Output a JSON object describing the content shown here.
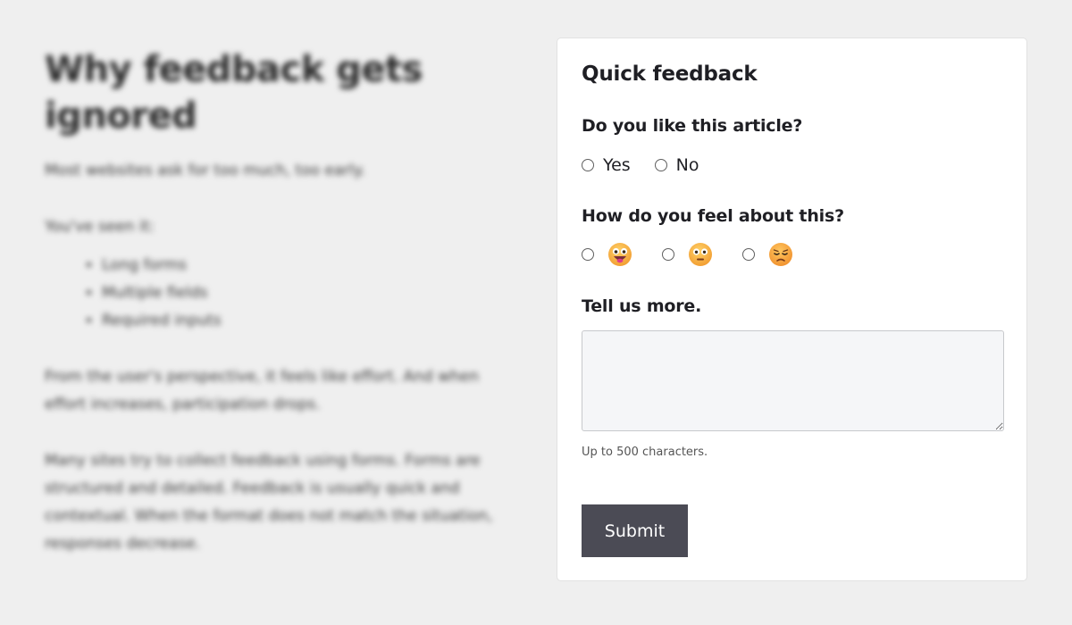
{
  "article": {
    "title": "Why feedback gets ignored",
    "intro": "Most websites ask for too much, too early.",
    "lead_in": "You've seen it:",
    "list_items": [
      "Long forms",
      "Multiple fields",
      "Required inputs"
    ],
    "paragraph_1": "From the user's perspective, it feels like effort. And when effort increases, participation drops.",
    "paragraph_2": "Many sites try to collect feedback using forms. Forms are structured and detailed. Feedback is usually quick and contextual. When the format does not match the situation, responses decrease."
  },
  "feedback": {
    "title": "Quick feedback",
    "question_1": {
      "label": "Do you like this article?",
      "options": [
        "Yes",
        "No"
      ]
    },
    "question_2": {
      "label": "How do you feel about this?",
      "options": [
        {
          "icon": "happy-face-icon",
          "color": "#f6a63a"
        },
        {
          "icon": "neutral-face-icon",
          "color": "#f6a63a"
        },
        {
          "icon": "sad-face-icon",
          "color": "#f6a63a"
        }
      ]
    },
    "question_3": {
      "label": "Tell us more.",
      "value": "",
      "placeholder": ""
    },
    "helper_text": "Up to 500 characters.",
    "submit_label": "Submit"
  },
  "colors": {
    "page_background": "#efefef",
    "card_background": "#ffffff",
    "button_background": "#4b4b55",
    "textarea_background": "#f5f6f8"
  }
}
